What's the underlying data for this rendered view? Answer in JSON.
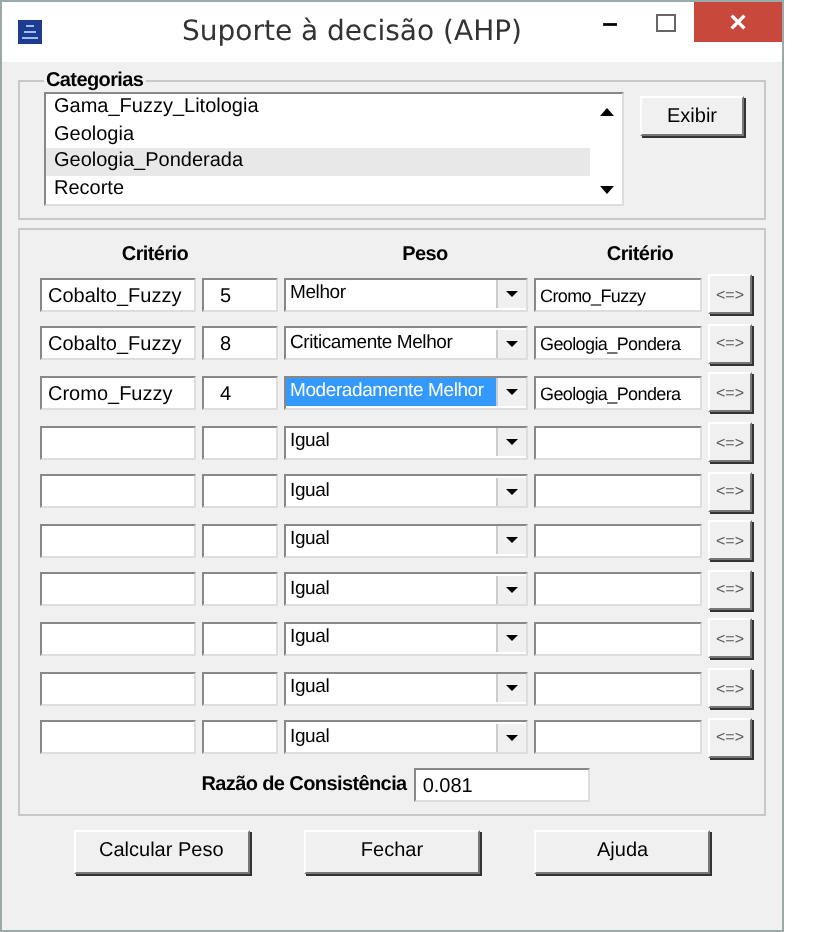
{
  "window": {
    "title": "Suporte à decisão (AHP)",
    "minimize": "–",
    "close": "×"
  },
  "categories": {
    "title": "Categorias",
    "items": [
      {
        "label": "Gama_Fuzzy_Litologia",
        "selected": false
      },
      {
        "label": "Geologia",
        "selected": false
      },
      {
        "label": "Geologia_Ponderada",
        "selected": true
      },
      {
        "label": "Recorte",
        "selected": false
      }
    ],
    "button": "Exibir"
  },
  "criteria": {
    "headers": [
      "Critério",
      "Peso",
      "Critério"
    ],
    "rows": [
      {
        "criterion_a": "Cobalto_Fuzzy",
        "weight": "5",
        "peso": "Melhor",
        "criterion_b": "Cromo_Fuzzy",
        "swap": "<=>",
        "selected": false
      },
      {
        "criterion_a": "Cobalto_Fuzzy",
        "weight": "8",
        "peso": "Criticamente Melhor",
        "criterion_b": "Geologia_Pondera",
        "swap": "<=>",
        "selected": false
      },
      {
        "criterion_a": "Cromo_Fuzzy",
        "weight": "4",
        "peso": "Moderadamente Melhor",
        "criterion_b": "Geologia_Pondera",
        "swap": "<=>",
        "selected": true
      },
      {
        "criterion_a": "",
        "weight": "",
        "peso": "Igual",
        "criterion_b": "",
        "swap": "<=>",
        "selected": false
      },
      {
        "criterion_a": "",
        "weight": "",
        "peso": "Igual",
        "criterion_b": "",
        "swap": "<=>",
        "selected": false
      },
      {
        "criterion_a": "",
        "weight": "",
        "peso": "Igual",
        "criterion_b": "",
        "swap": "<=>",
        "selected": false
      },
      {
        "criterion_a": "",
        "weight": "",
        "peso": "Igual",
        "criterion_b": "",
        "swap": "<=>",
        "selected": false
      },
      {
        "criterion_a": "",
        "weight": "",
        "peso": "Igual",
        "criterion_b": "",
        "swap": "<=>",
        "selected": false
      },
      {
        "criterion_a": "",
        "weight": "",
        "peso": "Igual",
        "criterion_b": "",
        "swap": "<=>",
        "selected": false
      },
      {
        "criterion_a": "",
        "weight": "",
        "peso": "Igual",
        "criterion_b": "",
        "swap": "<=>",
        "selected": false
      }
    ],
    "consistency_label": "Razão de Consistência",
    "consistency_value": "0.081"
  },
  "buttons": [
    "Calcular Peso",
    "Fechar",
    "Ajuda"
  ]
}
